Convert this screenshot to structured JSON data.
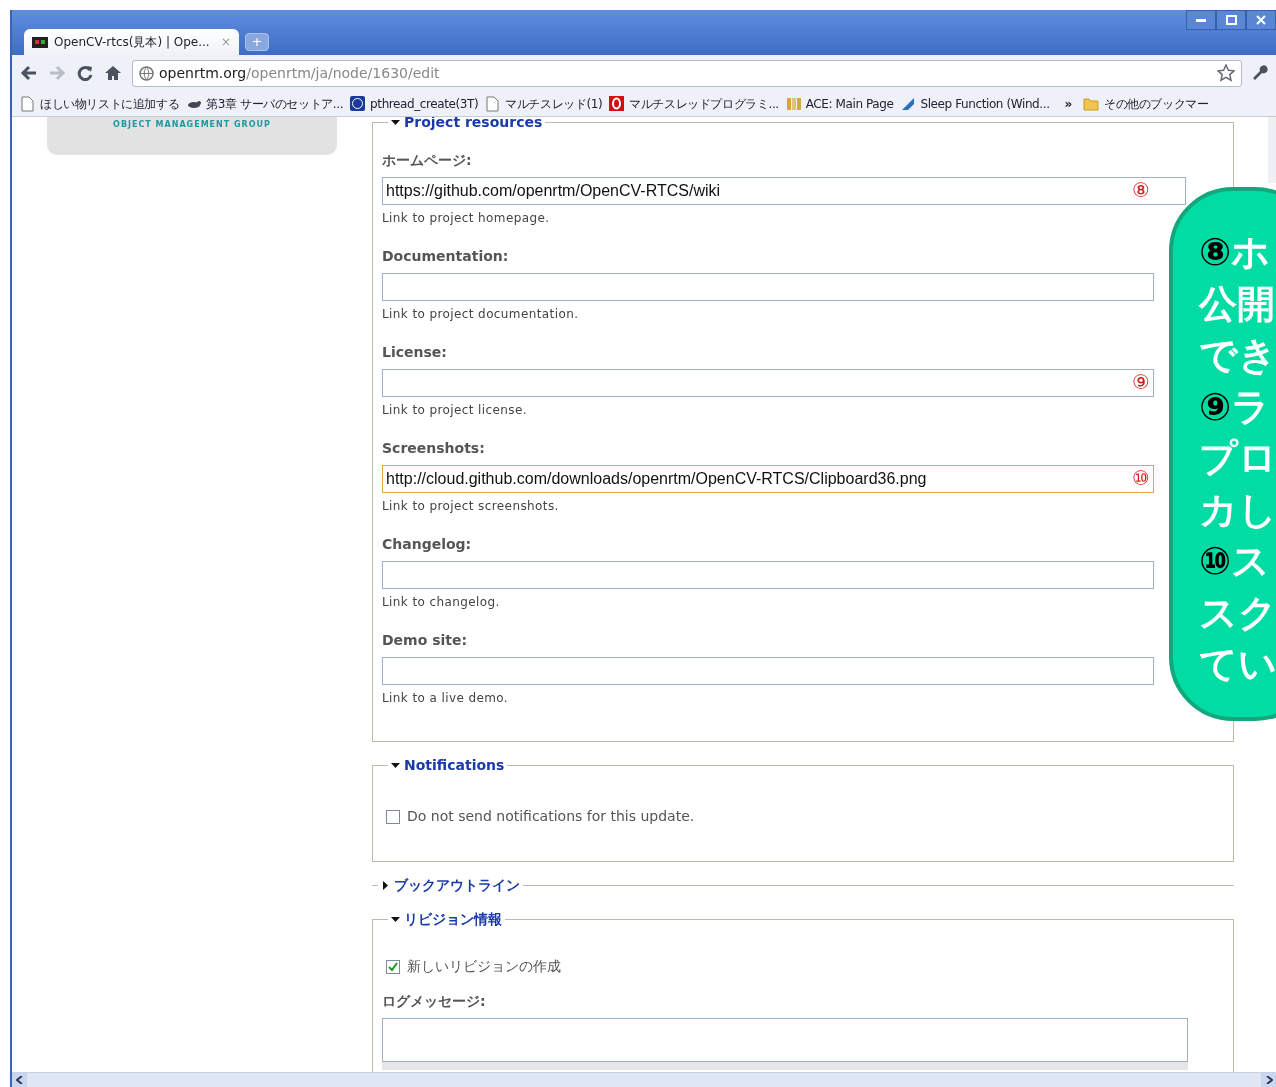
{
  "browser": {
    "tabs": [
      {
        "title": "OpenCV-rtcs(見本) | Ope...",
        "close": "×",
        "selected": true
      }
    ],
    "new_tab": "+",
    "address": {
      "domain": "openrtm.org",
      "path": "/openrtm/ja/node/1630/edit"
    },
    "bookmarks": [
      {
        "label": "ほしい物リストに追加する"
      },
      {
        "label": "第3章 サーバのセットア..."
      },
      {
        "label": "pthread_create(3T)"
      },
      {
        "label": "マルチスレッド(1)"
      },
      {
        "label": "マルチスレッドプログラミ..."
      },
      {
        "label": "ACE: Main Page"
      },
      {
        "label": "Sleep Function (Wind..."
      }
    ],
    "bookmarks_overflow": "»",
    "other_bookmarks": "その他のブックマー"
  },
  "sidebar": {
    "logo_text": "OBJECT MANAGEMENT GROUP"
  },
  "sections": [
    {
      "kind": "fields",
      "legend": "Project resources",
      "expanded": true,
      "fields": [
        {
          "label": "ホームページ:",
          "value": "https://github.com/openrtm/OpenCV-RTCS/wiki",
          "marker": "⑧",
          "description": "Link to project homepage.",
          "focused": false
        },
        {
          "label": "Documentation:",
          "description": "Link to project documentation.",
          "focused": false
        },
        {
          "label": "License:",
          "marker": "⑨",
          "description": "Link to project license.",
          "focused": false
        },
        {
          "label": "Screenshots:",
          "value": "http://cloud.github.com/downloads/openrtm/OpenCV-RTCS/Clipboard36.png",
          "marker": "⑩",
          "description": "Link to project screenshots.",
          "focused": true
        },
        {
          "label": "Changelog:",
          "description": "Link to changelog.",
          "focused": false
        },
        {
          "label": "Demo site:",
          "description": "Link to a live demo.",
          "focused": false
        }
      ]
    },
    {
      "kind": "checkbox",
      "legend": "Notifications",
      "expanded": true,
      "checkbox": {
        "label": "Do not send notifications for this update.",
        "checked": false
      }
    },
    {
      "kind": "collapsed",
      "legend": "ブックアウトライン",
      "expanded": false
    },
    {
      "kind": "revision",
      "legend": "リビジョン情報",
      "expanded": true,
      "checkbox": {
        "label": "新しいリビジョンの作成",
        "checked": true
      },
      "textarea_label": "ログメッセージ:"
    }
  ],
  "callout": {
    "lines": [
      {
        "marker": "⑧",
        "text": "ホ"
      },
      {
        "text": "公開"
      },
      {
        "text": "でき"
      },
      {
        "marker": "⑨",
        "text": "ラ"
      },
      {
        "text": "プロ"
      },
      {
        "text": "カし"
      },
      {
        "marker": "⑩",
        "text": "ス"
      },
      {
        "text": "スク"
      },
      {
        "text": "てい"
      }
    ]
  }
}
